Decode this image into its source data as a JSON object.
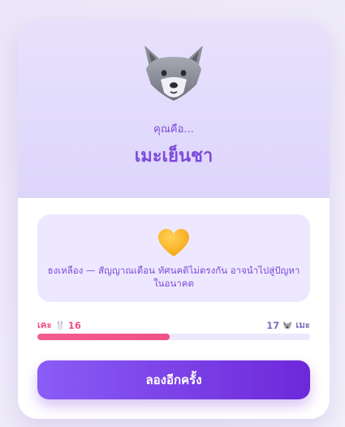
{
  "result_card": {
    "subtitle": "คุณคือ...",
    "result_title": "เมะเย็นชา",
    "hero_icon": "wolf-face-icon"
  },
  "info": {
    "icon": "yellow-heart-icon",
    "text": "ธงเหลือง — สัญญาณเตือน ทัศนคติไม่ตรงกัน อาจนำไปสู่ปัญหาในอนาคต"
  },
  "score": {
    "left_label": "เคะ",
    "left_icon": "rabbit-icon",
    "left_value": "16",
    "right_value": "17",
    "right_icon": "wolf-icon",
    "right_label": "เมะ",
    "fill_fraction": 0.485
  },
  "actions": {
    "retry_label": "ลองอีกครั้ง"
  },
  "colors": {
    "accent": "#7c4ad8",
    "pink": "#f0508a",
    "button_start": "#8b5cf6",
    "button_end": "#6d28d9"
  }
}
